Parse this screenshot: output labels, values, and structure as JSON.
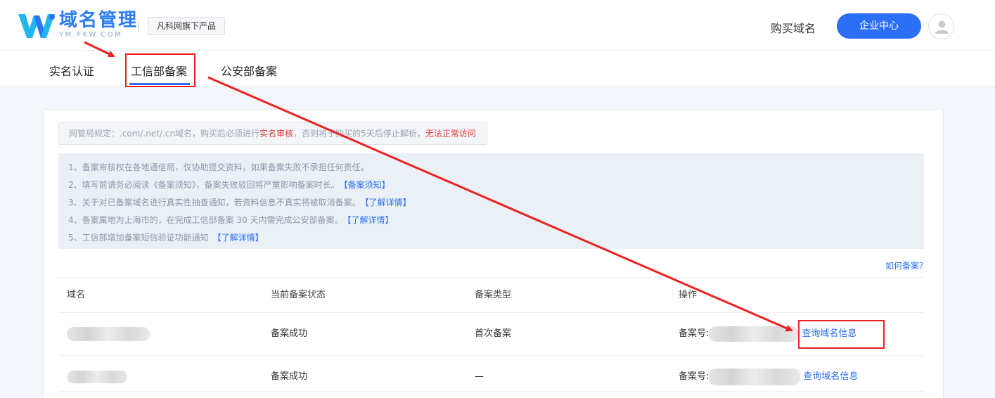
{
  "header": {
    "brand_title": "域名管理",
    "brand_sub": "YM.FKW.COM",
    "product_tag": "凡科网旗下产品",
    "buy_domain": "购买域名",
    "enterprise_center": "企业中心"
  },
  "nav": {
    "tabs": [
      {
        "label": "实名认证"
      },
      {
        "label": "工信部备案"
      },
      {
        "label": "公安部备案"
      }
    ]
  },
  "notice": {
    "prefix": "网管局规定：.com/.net/.cn域名，购买后必须进行",
    "highlight1": "实名审核",
    "middle": "，否则将于购买的5天后停止解析，",
    "highlight2": "无法正常访问"
  },
  "info": [
    {
      "text": "1、备案审核权在各地通信局，仅协助提交资料，如果备案失败不承担任何责任。",
      "link": ""
    },
    {
      "text": "2、填写前请务必阅读《备案须知》，备案失败驳回将严重影响备案时长。",
      "link": "【备案须知】"
    },
    {
      "text": "3、关于对已备案域名进行真实性抽查通知，若资料信息不真实将被取消备案。",
      "link": "【了解详情】"
    },
    {
      "text": "4、备案属地为上海市的，在完成工信部备案 30 天内需完成公安部备案。",
      "link": "【了解详情】"
    },
    {
      "text": "5、工信部增加备案短信验证功能通知",
      "link": "【了解详情】"
    }
  ],
  "how_link": "如何备案？",
  "table": {
    "headers": [
      "域名",
      "当前备案状态",
      "备案类型",
      "操作"
    ],
    "rows": [
      {
        "status": "备案成功",
        "type": "首次备案",
        "record_label": "备案号:",
        "action": "查询域名信息"
      },
      {
        "status": "备案成功",
        "type": "—",
        "record_label": "备案号:",
        "action": "查询域名信息"
      }
    ]
  },
  "colors": {
    "accent": "#2a6ff6",
    "annotation": "#ef2121",
    "highlight_text": "#e53935"
  }
}
